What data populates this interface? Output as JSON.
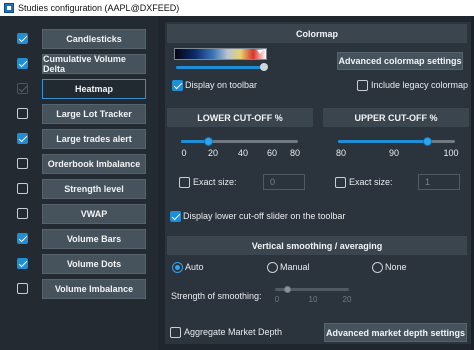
{
  "window": {
    "title": "Studies configuration (AAPL@DXFEED)"
  },
  "studies": [
    {
      "label": "Candlesticks",
      "checked": "on",
      "active": false
    },
    {
      "label": "Cumulative Volume Delta",
      "checked": "on",
      "active": false
    },
    {
      "label": "Heatmap",
      "checked": "dim",
      "active": true
    },
    {
      "label": "Large Lot Tracker",
      "checked": "off",
      "active": false
    },
    {
      "label": "Large trades alert",
      "checked": "on",
      "active": false
    },
    {
      "label": "Orderbook Imbalance",
      "checked": "off",
      "active": false
    },
    {
      "label": "Strength level",
      "checked": "off",
      "active": false
    },
    {
      "label": "VWAP",
      "checked": "off",
      "active": false
    },
    {
      "label": "Volume Bars",
      "checked": "on",
      "active": false
    },
    {
      "label": "Volume Dots",
      "checked": "on",
      "active": false
    },
    {
      "label": "Volume Imbalance",
      "checked": "off",
      "active": false
    }
  ],
  "colormap": {
    "header": "Colormap",
    "advanced_button": "Advanced colormap settings",
    "display_on_toolbar": "Display on toolbar",
    "include_legacy": "Include legacy colormap"
  },
  "lower_cutoff": {
    "header": "LOWER CUT-OFF %",
    "ticks": [
      "0",
      "20",
      "40",
      "60",
      "80"
    ],
    "value": 20,
    "exact_label": "Exact size:",
    "exact_value": "0"
  },
  "upper_cutoff": {
    "header": "UPPER CUT-OFF %",
    "ticks": [
      "80",
      "90",
      "100"
    ],
    "value": 96,
    "exact_label": "Exact size:",
    "exact_value": "1"
  },
  "toolbar_slider_label": "Display lower cut-off slider on the toolbar",
  "smoothing": {
    "header": "Vertical smoothing / averaging",
    "options": [
      "Auto",
      "Manual",
      "None"
    ],
    "selected": "Auto",
    "strength_label": "Strength of smoothing:",
    "ticks": [
      "0",
      "10",
      "20"
    ]
  },
  "aggregate_label": "Aggregate Market Depth",
  "advanced_depth_button": "Advanced market depth settings",
  "colors": {
    "accent": "#1e8fd6",
    "button": "#46525c",
    "panel": "#2b343c",
    "background": "#1f262d"
  }
}
